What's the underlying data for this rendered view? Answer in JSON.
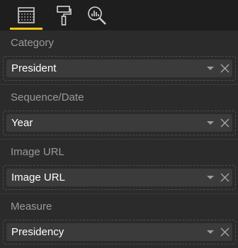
{
  "tabs": [
    {
      "name": "fields",
      "icon": "fields-grid-icon",
      "active": true
    },
    {
      "name": "format",
      "icon": "paint-roller-icon",
      "active": false
    },
    {
      "name": "analytics",
      "icon": "magnifier-chart-icon",
      "active": false
    }
  ],
  "colors": {
    "accent": "#f2c811",
    "label": "#9a9a9a",
    "pill": "#3b3b3b",
    "background": "#2b2b2b",
    "topbar": "#1e1e1e"
  },
  "wells": [
    {
      "label": "Category",
      "field": "President"
    },
    {
      "label": "Sequence/Date",
      "field": "Year"
    },
    {
      "label": "Image URL",
      "field": "Image URL"
    },
    {
      "label": "Measure",
      "field": "Presidency"
    }
  ]
}
